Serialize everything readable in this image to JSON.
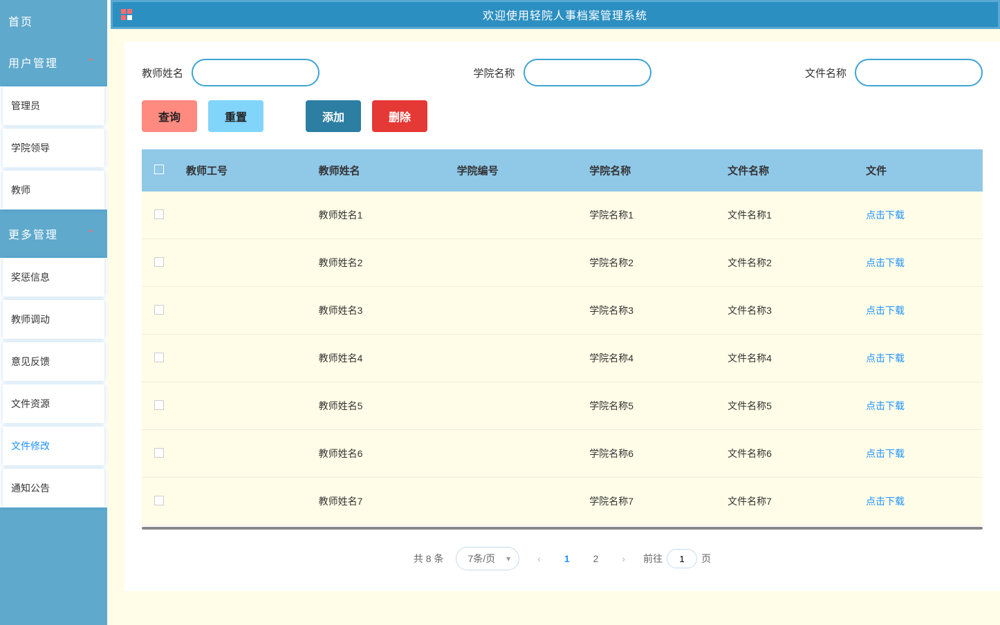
{
  "header": {
    "title": "欢迎使用轻院人事档案管理系统"
  },
  "sidebar": {
    "home": "首页",
    "groups": [
      {
        "label": "用户管理",
        "items": [
          "管理员",
          "学院领导",
          "教师"
        ]
      },
      {
        "label": "更多管理",
        "items": [
          "奖惩信息",
          "教师调动",
          "意见反馈",
          "文件资源",
          "文件修改",
          "通知公告"
        ]
      }
    ],
    "activeItem": "文件修改"
  },
  "filters": {
    "teacherName": {
      "label": "教师姓名",
      "value": ""
    },
    "collegeName": {
      "label": "学院名称",
      "value": ""
    },
    "fileName": {
      "label": "文件名称",
      "value": ""
    }
  },
  "buttons": {
    "search": "查询",
    "reset": "重置",
    "add": "添加",
    "delete": "删除"
  },
  "table": {
    "headers": [
      "教师工号",
      "教师姓名",
      "学院编号",
      "学院名称",
      "文件名称",
      "文件"
    ],
    "downloadLabel": "点击下载",
    "rows": [
      {
        "teacherId": "",
        "teacherName": "教师姓名1",
        "collegeId": "",
        "collegeName": "学院名称1",
        "fileName": "文件名称1"
      },
      {
        "teacherId": "",
        "teacherName": "教师姓名2",
        "collegeId": "",
        "collegeName": "学院名称2",
        "fileName": "文件名称2"
      },
      {
        "teacherId": "",
        "teacherName": "教师姓名3",
        "collegeId": "",
        "collegeName": "学院名称3",
        "fileName": "文件名称3"
      },
      {
        "teacherId": "",
        "teacherName": "教师姓名4",
        "collegeId": "",
        "collegeName": "学院名称4",
        "fileName": "文件名称4"
      },
      {
        "teacherId": "",
        "teacherName": "教师姓名5",
        "collegeId": "",
        "collegeName": "学院名称5",
        "fileName": "文件名称5"
      },
      {
        "teacherId": "",
        "teacherName": "教师姓名6",
        "collegeId": "",
        "collegeName": "学院名称6",
        "fileName": "文件名称6"
      },
      {
        "teacherId": "",
        "teacherName": "教师姓名7",
        "collegeId": "",
        "collegeName": "学院名称7",
        "fileName": "文件名称7"
      }
    ]
  },
  "pagination": {
    "total": "共 8 条",
    "perPage": "7条/页",
    "pages": [
      "1",
      "2"
    ],
    "current": "1",
    "gotoPrefix": "前往",
    "gotoSuffix": "页",
    "gotoValue": "1"
  }
}
